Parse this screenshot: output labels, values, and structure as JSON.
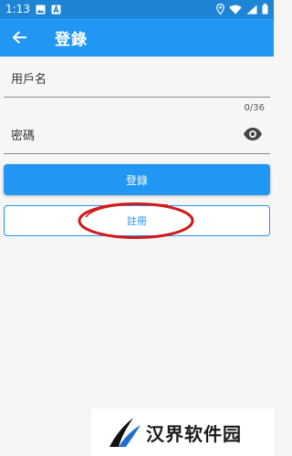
{
  "status_bar": {
    "time": "1:13",
    "left_icons": [
      "image-icon",
      "a-letter-icon"
    ],
    "right_icons": [
      "location-icon",
      "wifi-icon",
      "signal-icon",
      "battery-icon"
    ]
  },
  "app_bar": {
    "title": "登錄",
    "back_icon": "arrow-left-icon",
    "color": "#2196f3"
  },
  "form": {
    "username": {
      "label": "用戶名",
      "value": "",
      "counter": "0/36"
    },
    "password": {
      "label": "密碼",
      "value": "",
      "toggle_icon": "eye-icon"
    },
    "login_label": "登錄",
    "register_label": "註冊"
  },
  "annotation": {
    "color": "#d11a1a"
  },
  "watermark": {
    "text": "汉界软件园"
  }
}
